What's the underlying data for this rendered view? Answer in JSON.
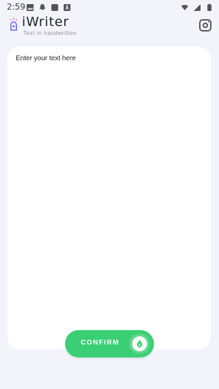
{
  "status_bar": {
    "time": "2:59",
    "left_icons": [
      "image-icon",
      "snapchat-icon",
      "app-icon",
      "font-icon"
    ],
    "right_icons": [
      "wifi-icon",
      "signal-icon",
      "battery-icon"
    ]
  },
  "header": {
    "title": "iWriter",
    "subtitle": "Text in handwritten",
    "logo_icon": "pen-light-icon",
    "social_icon": "instagram-icon"
  },
  "editor": {
    "input_value": "Enter your text here"
  },
  "actions": {
    "confirm_label": "CONFIRM",
    "confirm_icon": "pen-nib-icon"
  },
  "colors": {
    "background": "#f3f4fb",
    "accent": "#3bcf75",
    "logo_primary": "#6c63ff",
    "logo_accent": "#ff5fa2"
  }
}
